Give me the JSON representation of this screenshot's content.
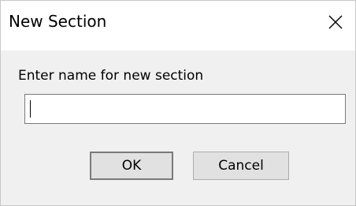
{
  "dialog": {
    "title": "New Section",
    "close_glyph": "✕",
    "prompt": "Enter name for new section",
    "input_value": "",
    "ok_label": "OK",
    "cancel_label": "Cancel"
  },
  "icons": {
    "close": "close-icon"
  },
  "colors": {
    "content_background": "#f0f0f0",
    "button_background": "#e1e1e1",
    "input_border": "#7a7a7a"
  }
}
